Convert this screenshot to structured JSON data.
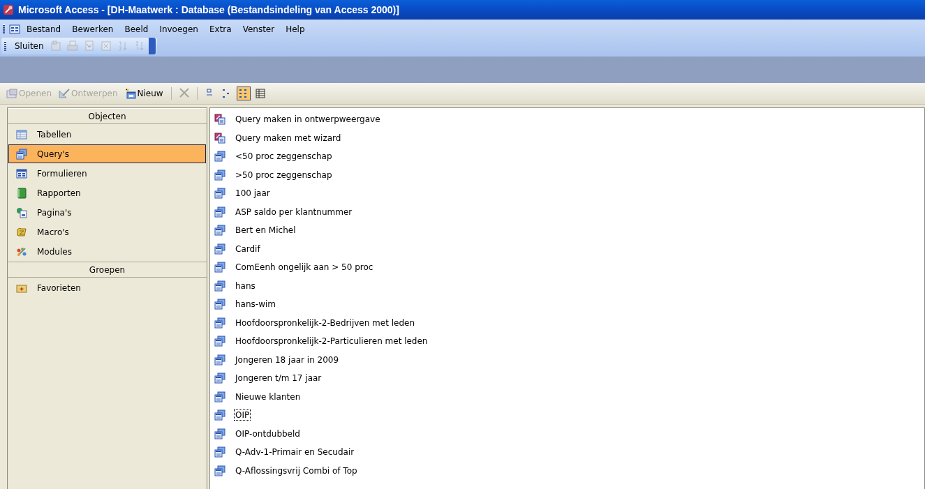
{
  "window": {
    "title": "Microsoft Access - [DH-Maatwerk : Database (Bestandsindeling van Access 2000)]"
  },
  "menu_bar": [
    "Bestand",
    "Bewerken",
    "Beeld",
    "Invoegen",
    "Extra",
    "Venster",
    "Help"
  ],
  "toolbar": [
    {
      "kind": "close",
      "label": "Sluiten",
      "disabled": false
    },
    {
      "kind": "properties",
      "disabled": true
    },
    {
      "kind": "print",
      "disabled": true
    },
    {
      "kind": "word",
      "disabled": true
    },
    {
      "kind": "excel",
      "disabled": true
    },
    {
      "kind": "sortup",
      "disabled": true
    },
    {
      "kind": "sortdown",
      "disabled": true
    }
  ],
  "database_toolbar": [
    {
      "kind": "open",
      "label": "Openen",
      "disabled": true
    },
    {
      "kind": "design",
      "label": "Ontwerpen",
      "disabled": true
    },
    {
      "kind": "new",
      "label": "Nieuw",
      "disabled": false
    },
    {
      "kind": "delete",
      "disabled": true
    },
    {
      "kind": "large",
      "selected": false
    },
    {
      "kind": "small",
      "selected": false
    },
    {
      "kind": "list",
      "selected": true
    },
    {
      "kind": "details",
      "selected": false
    }
  ],
  "sidebar": {
    "sections": [
      {
        "header": "Objecten",
        "items": [
          {
            "label": "Tabellen",
            "kind": "table",
            "selected": false
          },
          {
            "label": "Query's",
            "kind": "query",
            "selected": true
          },
          {
            "label": "Formulieren",
            "kind": "form",
            "selected": false
          },
          {
            "label": "Rapporten",
            "kind": "report",
            "selected": false
          },
          {
            "label": "Pagina's",
            "kind": "page",
            "selected": false
          },
          {
            "label": "Macro's",
            "kind": "macro",
            "selected": false
          },
          {
            "label": "Modules",
            "kind": "module",
            "selected": false
          }
        ]
      },
      {
        "header": "Groepen",
        "items": [
          {
            "label": "Favorieten",
            "kind": "favorites",
            "selected": false
          }
        ]
      }
    ]
  },
  "objects": [
    {
      "label": "Query maken in ontwerpweergave",
      "kind": "shortcut",
      "focused": false
    },
    {
      "label": "Query maken met wizard",
      "kind": "shortcut",
      "focused": false
    },
    {
      "label": "<50 proc zeggenschap",
      "kind": "query",
      "focused": false
    },
    {
      "label": ">50 proc zeggenschap",
      "kind": "query",
      "focused": false
    },
    {
      "label": "100 jaar",
      "kind": "query",
      "focused": false
    },
    {
      "label": "ASP saldo per klantnummer",
      "kind": "query",
      "focused": false
    },
    {
      "label": "Bert en Michel",
      "kind": "query",
      "focused": false
    },
    {
      "label": "Cardif",
      "kind": "query",
      "focused": false
    },
    {
      "label": "ComEenh ongelijk aan > 50 proc",
      "kind": "query",
      "focused": false
    },
    {
      "label": "hans",
      "kind": "query",
      "focused": false
    },
    {
      "label": "hans-wim",
      "kind": "query",
      "focused": false
    },
    {
      "label": "Hoofdoorspronkelijk-2-Bedrijven met leden",
      "kind": "query",
      "focused": false
    },
    {
      "label": "Hoofdoorspronkelijk-2-Particulieren met leden",
      "kind": "query",
      "focused": false
    },
    {
      "label": "Jongeren 18 jaar in 2009",
      "kind": "query",
      "focused": false
    },
    {
      "label": "Jongeren t/m 17 jaar",
      "kind": "query",
      "focused": false
    },
    {
      "label": "Nieuwe klanten",
      "kind": "query",
      "focused": false
    },
    {
      "label": "OIP",
      "kind": "query",
      "focused": true
    },
    {
      "label": "OIP-ontdubbeld",
      "kind": "query",
      "focused": false
    },
    {
      "label": "Q-Adv-1-Primair en Secudair",
      "kind": "query",
      "focused": false
    },
    {
      "label": "Q-Aflossingsvrij Combi of Top",
      "kind": "query",
      "focused": false
    }
  ]
}
